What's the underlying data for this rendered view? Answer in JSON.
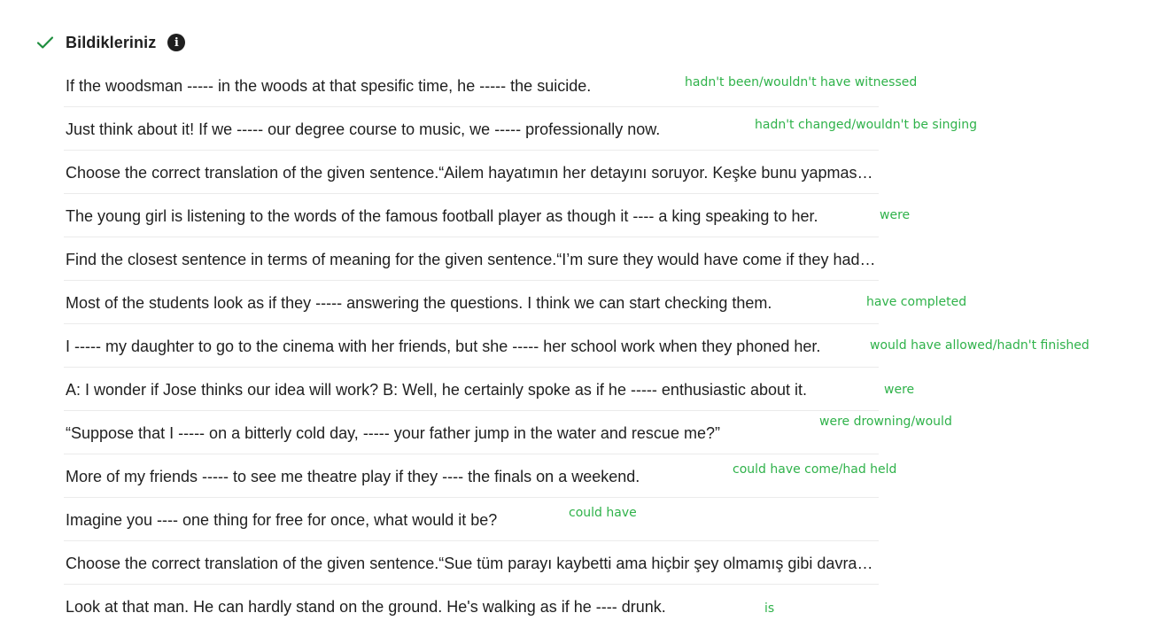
{
  "section": {
    "title": "Bildikleriniz",
    "check_color": "#1e8e3e",
    "info_icon": "info-icon"
  },
  "items": [
    {
      "question": "If the woodsman ----- in the woods at that spesific time, he ----- the suicide.",
      "answer": "hadn't been/wouldn't have witnessed"
    },
    {
      "question": "Just think about it! If we ----- our degree course to music, we ----- professionally now.",
      "answer": "hadn't changed/wouldn't be singing"
    },
    {
      "question": "Choose the correct translation of the given sentence.“Ailem hayatımın her detayını soruyor. Keşke bunu yapmasalar.”",
      "answer": ""
    },
    {
      "question": "The young girl is listening to the words of the famous football player as though it ---- a king speaking to her.",
      "answer": "were"
    },
    {
      "question": "Find the closest sentence in terms of meaning for the given sentence.“I’m sure they would have come if they had been invited.”",
      "answer": ""
    },
    {
      "question": "Most of the students look as if they ----- answering the questions. I think we can start checking them.",
      "answer": "have completed"
    },
    {
      "question": "I ----- my daughter to go to the cinema with her friends, but she ----- her school work when they phoned her.",
      "answer": "would have allowed/hadn't finished"
    },
    {
      "question": "A: I wonder if Jose thinks our idea will work? B: Well, he certainly spoke as if he ----- enthusiastic about it.",
      "answer": "were"
    },
    {
      "question": "“Suppose that I ----- on a bitterly cold day, ----- your father jump in the water and rescue me?”",
      "answer": "were drowning/would"
    },
    {
      "question": "More of my friends ----- to see me theatre play if they ---- the finals on a weekend.",
      "answer": "could have come/had held"
    },
    {
      "question": "Imagine you ---- one thing for free for once, what would it be?",
      "answer": "could have"
    },
    {
      "question": "Choose the correct translation of the given sentence.“Sue tüm parayı kaybetti ama hiçbir şey olmamış gibi davranıyor.”",
      "answer": ""
    },
    {
      "question": "Look at that man. He can hardly stand on the ground. He's walking as if he ---- drunk.",
      "answer": "is"
    }
  ]
}
